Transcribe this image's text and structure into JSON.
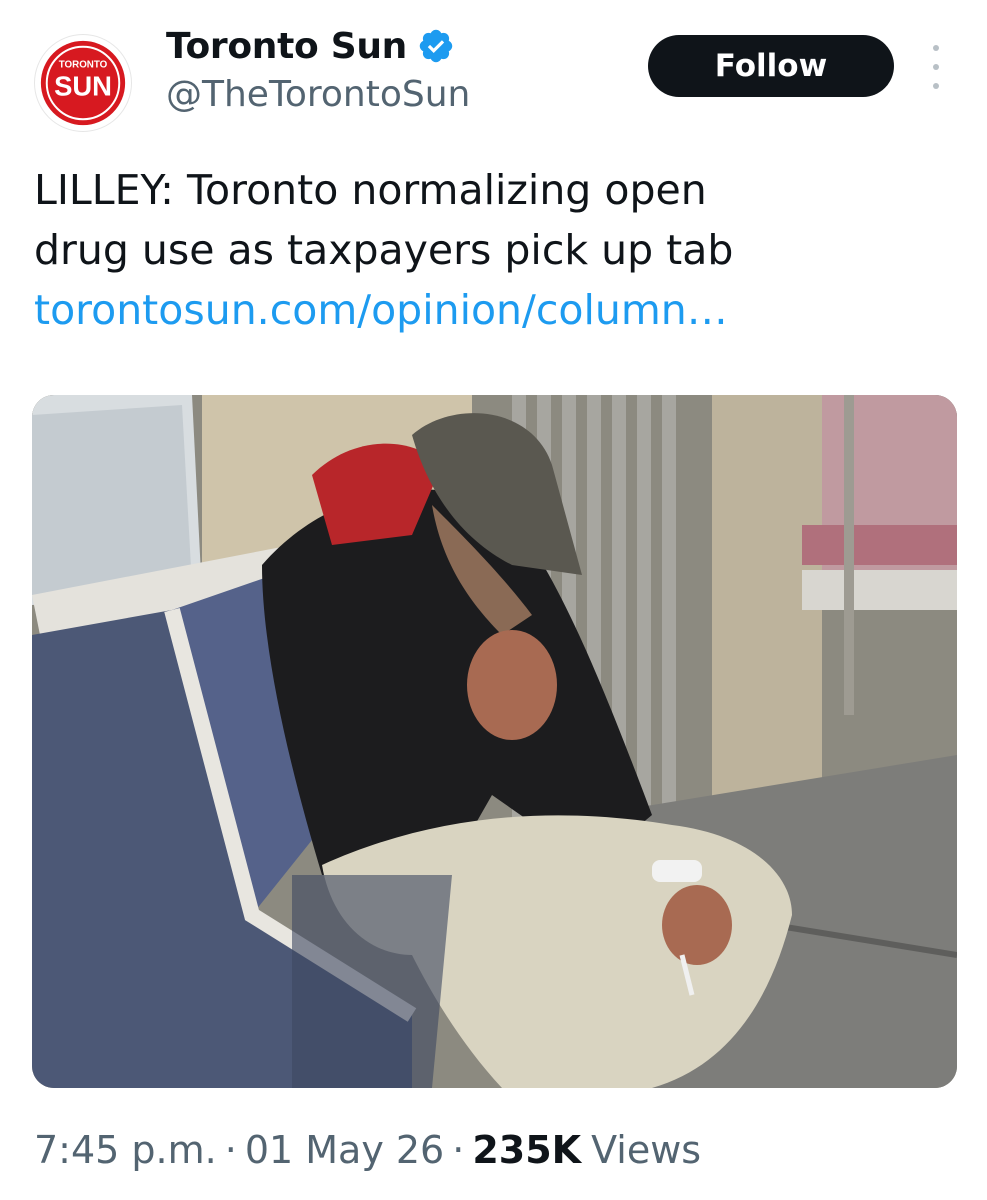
{
  "account": {
    "display_name": "Toronto Sun",
    "handle": "@TheTorontoSun",
    "avatar_small_text": "TORONTO",
    "avatar_big_text": "SUN"
  },
  "actions": {
    "follow_label": "Follow"
  },
  "tweet": {
    "text_line_1": "LILLEY: Toronto normalizing open",
    "text_line_2": "drug use as taxpayers pick up tab",
    "link_text": "torontosun.com/opinion/column…"
  },
  "meta": {
    "time": "7:45 p.m.",
    "dot1": "·",
    "date": "01 May 26",
    "dot2": "·",
    "views_count": "235K",
    "views_label": "Views"
  },
  "icons": {
    "verified": "verified-badge-icon",
    "more": "more-options-icon"
  },
  "colors": {
    "brand_red": "#d71920",
    "verified_blue": "#1d9bf0",
    "link_blue": "#1d9bf0",
    "follow_bg": "#0f1419",
    "secondary_text": "#536471"
  }
}
